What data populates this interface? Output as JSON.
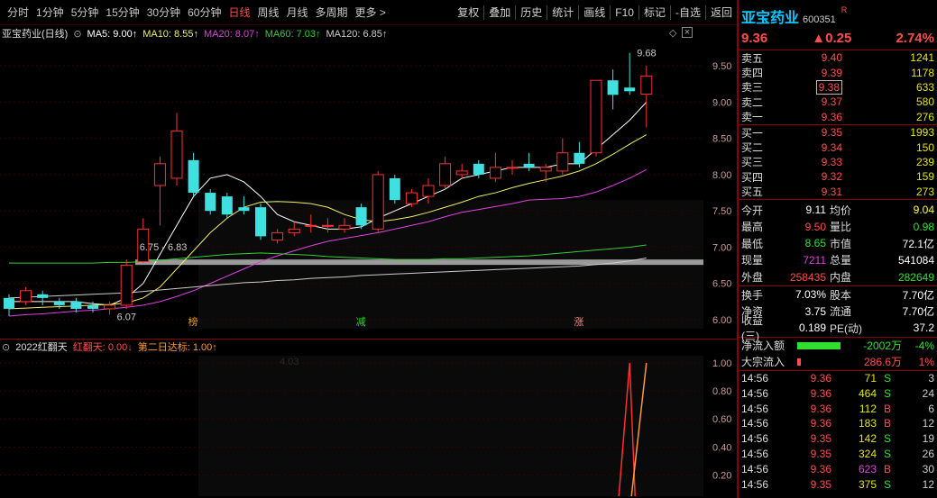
{
  "toolbar": {
    "periods": [
      "分时",
      "1分钟",
      "5分钟",
      "15分钟",
      "30分钟",
      "60分钟",
      "日线",
      "周线",
      "月线",
      "多周期",
      "更多 >"
    ],
    "active_period": "日线",
    "buttons": [
      "复权",
      "叠加",
      "历史",
      "统计",
      "画线",
      "F10",
      "标记",
      "-自选",
      "返回"
    ]
  },
  "main_chart": {
    "title": "亚宝药业(日线)",
    "ma": [
      {
        "label": "MA5: 9.00↑",
        "color": "#ffffff"
      },
      {
        "label": "MA10: 8.55↑",
        "color": "#f0f060"
      },
      {
        "label": "MA20: 8.07↑",
        "color": "#e040e0"
      },
      {
        "label": "MA60: 7.03↑",
        "color": "#30d030"
      },
      {
        "label": "MA120: 6.85↑",
        "color": "#cccccc"
      }
    ],
    "price_axis": [
      "9.50",
      "9.00",
      "8.50",
      "8.00",
      "7.50",
      "7.00",
      "6.50",
      "6.00"
    ],
    "annotations": {
      "high": "9.68",
      "low": "6.07",
      "range": "6.75 - 6.83",
      "mark1": "榜",
      "mark2": "减",
      "mark3": "涨"
    }
  },
  "indicator": {
    "name": "2022红翻天",
    "line1": "红翻天: 0.00↓",
    "line2": "第二日达标: 1.00↑",
    "axis": [
      "1.00",
      "0.80",
      "0.60",
      "0.40",
      "0.20"
    ],
    "watermark": "4.03"
  },
  "chart_data": {
    "type": "candlestick",
    "title": "亚宝药业(日线)",
    "ylim": [
      6.0,
      9.7
    ],
    "candles": [
      {
        "o": 6.3,
        "c": 6.15,
        "h": 6.35,
        "l": 6.05
      },
      {
        "o": 6.25,
        "c": 6.4,
        "h": 6.45,
        "l": 6.2
      },
      {
        "o": 6.35,
        "c": 6.3,
        "h": 6.4,
        "l": 6.2
      },
      {
        "o": 6.25,
        "c": 6.2,
        "h": 6.3,
        "l": 6.15
      },
      {
        "o": 6.25,
        "c": 6.15,
        "h": 6.3,
        "l": 6.1
      },
      {
        "o": 6.2,
        "c": 6.15,
        "h": 6.25,
        "l": 6.1
      },
      {
        "o": 6.15,
        "c": 6.2,
        "h": 6.25,
        "l": 6.07
      },
      {
        "o": 6.2,
        "c": 6.75,
        "h": 6.83,
        "l": 6.15
      },
      {
        "o": 6.8,
        "c": 7.25,
        "h": 7.4,
        "l": 6.78
      },
      {
        "o": 7.85,
        "c": 8.15,
        "h": 8.25,
        "l": 7.3
      },
      {
        "o": 7.95,
        "c": 8.6,
        "h": 8.85,
        "l": 7.85
      },
      {
        "o": 8.2,
        "c": 7.75,
        "h": 8.3,
        "l": 7.7
      },
      {
        "o": 7.75,
        "c": 7.5,
        "h": 7.8,
        "l": 7.45
      },
      {
        "o": 7.7,
        "c": 7.45,
        "h": 7.75,
        "l": 7.4
      },
      {
        "o": 7.55,
        "c": 7.5,
        "h": 7.7,
        "l": 7.45
      },
      {
        "o": 7.55,
        "c": 7.15,
        "h": 7.6,
        "l": 7.1
      },
      {
        "o": 7.1,
        "c": 7.2,
        "h": 7.25,
        "l": 7.05
      },
      {
        "o": 7.2,
        "c": 7.25,
        "h": 7.35,
        "l": 7.15
      },
      {
        "o": 7.3,
        "c": 7.3,
        "h": 7.45,
        "l": 7.2
      },
      {
        "o": 7.3,
        "c": 7.3,
        "h": 7.4,
        "l": 7.2
      },
      {
        "o": 7.25,
        "c": 7.3,
        "h": 7.4,
        "l": 7.2
      },
      {
        "o": 7.55,
        "c": 7.3,
        "h": 7.6,
        "l": 7.25
      },
      {
        "o": 7.25,
        "c": 8.0,
        "h": 8.05,
        "l": 7.2
      },
      {
        "o": 7.95,
        "c": 7.65,
        "h": 8.0,
        "l": 7.6
      },
      {
        "o": 7.6,
        "c": 7.75,
        "h": 7.8,
        "l": 7.55
      },
      {
        "o": 7.7,
        "c": 7.85,
        "h": 7.95,
        "l": 7.6
      },
      {
        "o": 7.85,
        "c": 8.15,
        "h": 8.25,
        "l": 7.8
      },
      {
        "o": 8.0,
        "c": 8.05,
        "h": 8.15,
        "l": 7.95
      },
      {
        "o": 8.15,
        "c": 8.0,
        "h": 8.2,
        "l": 7.95
      },
      {
        "o": 7.95,
        "c": 8.1,
        "h": 8.3,
        "l": 7.9
      },
      {
        "o": 8.1,
        "c": 8.1,
        "h": 8.2,
        "l": 8.0
      },
      {
        "o": 8.15,
        "c": 8.1,
        "h": 8.3,
        "l": 8.05
      },
      {
        "o": 8.05,
        "c": 8.1,
        "h": 8.15,
        "l": 7.9
      },
      {
        "o": 8.05,
        "c": 8.3,
        "h": 8.5,
        "l": 8.0
      },
      {
        "o": 8.3,
        "c": 8.15,
        "h": 8.45,
        "l": 8.1
      },
      {
        "o": 8.3,
        "c": 9.3,
        "h": 9.3,
        "l": 8.25
      },
      {
        "o": 9.3,
        "c": 9.1,
        "h": 9.45,
        "l": 8.9
      },
      {
        "o": 9.2,
        "c": 9.15,
        "h": 9.68,
        "l": 9.1
      },
      {
        "o": 9.11,
        "c": 9.36,
        "h": 9.5,
        "l": 8.65
      }
    ],
    "ma_series": [
      {
        "name": "MA5",
        "values": [
          6.25,
          6.25,
          6.25,
          6.25,
          6.25,
          6.22,
          6.2,
          6.3,
          6.5,
          6.9,
          7.3,
          7.7,
          7.95,
          8.0,
          7.9,
          7.7,
          7.45,
          7.35,
          7.3,
          7.25,
          7.25,
          7.28,
          7.4,
          7.5,
          7.6,
          7.7,
          7.8,
          7.95,
          8.0,
          8.05,
          8.1,
          8.1,
          8.1,
          8.15,
          8.15,
          8.35,
          8.55,
          8.75,
          9.0
        ]
      },
      {
        "name": "MA10",
        "values": [
          6.15,
          6.16,
          6.17,
          6.18,
          6.19,
          6.2,
          6.21,
          6.23,
          6.3,
          6.45,
          6.7,
          6.95,
          7.2,
          7.4,
          7.55,
          7.62,
          7.63,
          7.62,
          7.6,
          7.55,
          7.45,
          7.38,
          7.35,
          7.38,
          7.42,
          7.48,
          7.55,
          7.62,
          7.7,
          7.75,
          7.82,
          7.88,
          7.93,
          7.98,
          8.05,
          8.15,
          8.28,
          8.42,
          8.55
        ]
      },
      {
        "name": "MA20",
        "values": [
          6.05,
          6.07,
          6.08,
          6.1,
          6.12,
          6.13,
          6.15,
          6.17,
          6.2,
          6.25,
          6.32,
          6.4,
          6.5,
          6.6,
          6.7,
          6.8,
          6.88,
          6.95,
          7.02,
          7.08,
          7.12,
          7.16,
          7.2,
          7.25,
          7.3,
          7.35,
          7.42,
          7.48,
          7.52,
          7.56,
          7.6,
          7.65,
          7.66,
          7.67,
          7.7,
          7.76,
          7.85,
          7.95,
          8.07
        ]
      },
      {
        "name": "MA60",
        "values": [
          6.78,
          6.78,
          6.78,
          6.78,
          6.78,
          6.78,
          6.79,
          6.79,
          6.8,
          6.82,
          6.84,
          6.86,
          6.88,
          6.9,
          6.91,
          6.92,
          6.91,
          6.9,
          6.89,
          6.87,
          6.86,
          6.85,
          6.84,
          6.83,
          6.83,
          6.83,
          6.84,
          6.84,
          6.85,
          6.86,
          6.87,
          6.88,
          6.9,
          6.92,
          6.94,
          6.96,
          6.98,
          7.0,
          7.03
        ]
      },
      {
        "name": "MA120",
        "values": [
          6.3,
          6.31,
          6.32,
          6.33,
          6.34,
          6.35,
          6.36,
          6.37,
          6.39,
          6.41,
          6.43,
          6.45,
          6.47,
          6.49,
          6.51,
          6.52,
          6.54,
          6.55,
          6.57,
          6.58,
          6.59,
          6.61,
          6.62,
          6.63,
          6.64,
          6.65,
          6.66,
          6.67,
          6.68,
          6.69,
          6.7,
          6.71,
          6.72,
          6.73,
          6.74,
          6.76,
          6.78,
          6.81,
          6.85
        ]
      }
    ]
  },
  "quote": {
    "name": "亚宝药业",
    "code": "600351",
    "flag": "R",
    "price": "9.36",
    "change": "▲0.25",
    "change_pct": "2.74%",
    "asks": [
      {
        "label": "卖五",
        "price": "9.40",
        "vol": "1241"
      },
      {
        "label": "卖四",
        "price": "9.39",
        "vol": "1178"
      },
      {
        "label": "卖三",
        "price": "9.38",
        "vol": "633"
      },
      {
        "label": "卖二",
        "price": "9.37",
        "vol": "580"
      },
      {
        "label": "卖一",
        "price": "9.36",
        "vol": "276"
      }
    ],
    "bids": [
      {
        "label": "买一",
        "price": "9.35",
        "vol": "1993"
      },
      {
        "label": "买二",
        "price": "9.34",
        "vol": "150"
      },
      {
        "label": "买三",
        "price": "9.33",
        "vol": "239"
      },
      {
        "label": "买四",
        "price": "9.32",
        "vol": "159"
      },
      {
        "label": "买五",
        "price": "9.31",
        "vol": "273"
      }
    ],
    "stats1": [
      {
        "l1": "今开",
        "v1": "9.11",
        "c1": "#ffffff",
        "l2": "均价",
        "v2": "9.04",
        "c2": "#ffff40"
      },
      {
        "l1": "最高",
        "v1": "9.50",
        "c1": "#ff4d4d",
        "l2": "量比",
        "v2": "0.98",
        "c2": "#30e030"
      },
      {
        "l1": "最低",
        "v1": "8.65",
        "c1": "#30e030",
        "l2": "市值",
        "v2": "72.1亿",
        "c2": "#ffffff"
      },
      {
        "l1": "现量",
        "v1": "7211",
        "c1": "#e040e0",
        "l2": "总量",
        "v2": "541084",
        "c2": "#ffffff"
      },
      {
        "l1": "外盘",
        "v1": "258435",
        "c1": "#ff4d4d",
        "l2": "内盘",
        "v2": "282649",
        "c2": "#30e030"
      }
    ],
    "stats2": [
      {
        "l1": "换手",
        "v1": "7.03%",
        "c1": "#ffffff",
        "l2": "股本",
        "v2": "7.70亿",
        "c2": "#ffffff"
      },
      {
        "l1": "净资",
        "v1": "3.75",
        "c1": "#ffffff",
        "l2": "流通",
        "v2": "7.70亿",
        "c2": "#ffffff"
      },
      {
        "l1": "收益(三)",
        "v1": "0.189",
        "c1": "#ffffff",
        "l2": "PE(动)",
        "v2": "37.2",
        "c2": "#ffffff"
      }
    ],
    "flows": [
      {
        "label": "净流入额",
        "value": "-2002万",
        "pct": "-4%",
        "color": "#30e030",
        "bar": 0.75
      },
      {
        "label": "大宗流入",
        "value": "286.6万",
        "pct": "1%",
        "color": "#ff4d4d",
        "bar": 0.06
      }
    ],
    "ticks": [
      {
        "time": "14:56",
        "price": "9.36",
        "vol": "71",
        "side": "S",
        "num": "3",
        "vcolor": "#e5e500"
      },
      {
        "time": "14:56",
        "price": "9.36",
        "vol": "464",
        "side": "S",
        "num": "24",
        "vcolor": "#e5e500"
      },
      {
        "time": "14:56",
        "price": "9.36",
        "vol": "112",
        "side": "B",
        "num": "6",
        "vcolor": "#e5e500"
      },
      {
        "time": "14:56",
        "price": "9.36",
        "vol": "183",
        "side": "B",
        "num": "12",
        "vcolor": "#e5e500"
      },
      {
        "time": "14:56",
        "price": "9.35",
        "vol": "142",
        "side": "S",
        "num": "19",
        "vcolor": "#e5e500"
      },
      {
        "time": "14:56",
        "price": "9.35",
        "vol": "324",
        "side": "S",
        "num": "26",
        "vcolor": "#e5e500"
      },
      {
        "time": "14:56",
        "price": "9.36",
        "vol": "623",
        "side": "B",
        "num": "30",
        "vcolor": "#e040e0"
      },
      {
        "time": "14:56",
        "price": "9.35",
        "vol": "375",
        "side": "S",
        "num": "12",
        "vcolor": "#e5e500"
      }
    ]
  }
}
